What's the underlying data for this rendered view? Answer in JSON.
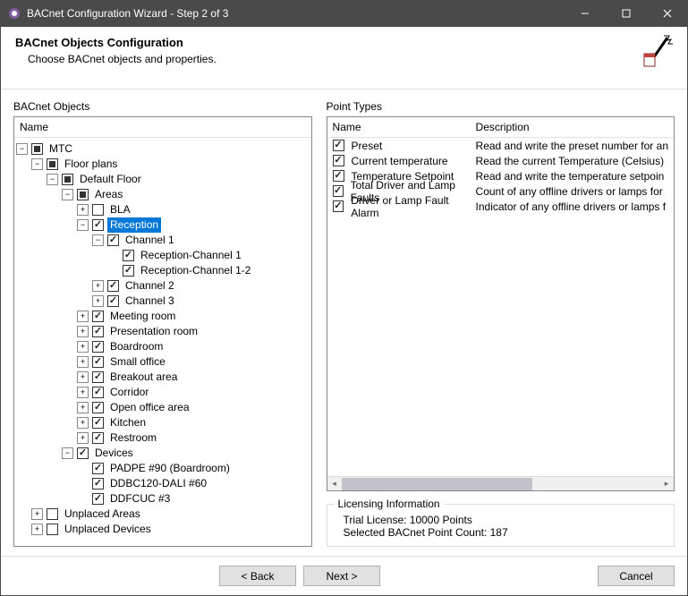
{
  "window": {
    "title": "BACnet Configuration Wizard - Step 2 of 3"
  },
  "header": {
    "title": "BACnet Objects Configuration",
    "subtitle": "Choose BACnet objects and properties."
  },
  "leftSection": {
    "label": "BACnet Objects",
    "columnHeader": "Name"
  },
  "tree": {
    "root": "MTC",
    "floorPlans": "Floor plans",
    "defaultFloor": "Default Floor",
    "areas": "Areas",
    "bla": "BLA",
    "reception": "Reception",
    "channel1": "Channel 1",
    "receptionCh1": "Reception-Channel 1",
    "receptionCh12": "Reception-Channel 1-2",
    "channel2": "Channel 2",
    "channel3": "Channel 3",
    "meeting": "Meeting room",
    "presentation": "Presentation room",
    "boardroom": "Boardroom",
    "smallOffice": "Small office",
    "breakout": "Breakout area",
    "corridor": "Corridor",
    "openOffice": "Open office area",
    "kitchen": "Kitchen",
    "restroom": "Restroom",
    "devices": "Devices",
    "dev1": "PADPE #90 (Boardroom)",
    "dev2": "DDBC120-DALI #60",
    "dev3": "DDFCUC #3",
    "unplacedAreas": "Unplaced Areas",
    "unplacedDevices": "Unplaced Devices"
  },
  "rightSection": {
    "label": "Point Types",
    "nameHeader": "Name",
    "descHeader": "Description"
  },
  "pointTypes": [
    {
      "name": "Preset",
      "desc": "Read and write the preset number for an"
    },
    {
      "name": "Current temperature",
      "desc": "Read the current Temperature (Celsius)"
    },
    {
      "name": "Temperature Setpoint",
      "desc": "Read and write the temperature setpoin"
    },
    {
      "name": "Total Driver and Lamp Faults",
      "desc": "Count of any offline drivers or lamps for"
    },
    {
      "name": "Driver or Lamp Fault Alarm",
      "desc": "Indicator of any offline drivers or lamps f"
    }
  ],
  "licensing": {
    "legend": "Licensing Information",
    "line1": "Trial License: 10000 Points",
    "line2": "Selected BACnet Point Count: 187"
  },
  "footer": {
    "back": "<  Back",
    "next": "Next  >",
    "cancel": "Cancel"
  }
}
